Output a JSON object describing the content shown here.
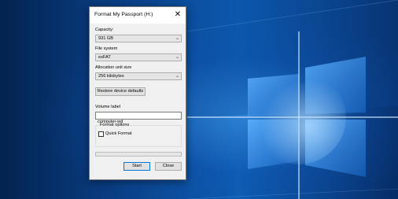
{
  "dialog": {
    "title": "Format My Passport (H:)",
    "capacity": {
      "label": "Capacity:",
      "value": "931 GB"
    },
    "file_system": {
      "label": "File system",
      "value": "exFAT"
    },
    "allocation": {
      "label": "Allocation unit size",
      "value": "256 kilobytes"
    },
    "restore_label": "Restore device defaults",
    "volume": {
      "label": "Volume label",
      "value": "computer-wd"
    },
    "format_options": {
      "title": "Format options",
      "quick_format_label": "Quick Format",
      "quick_format_checked": false
    },
    "progress": 0,
    "start_label": "Start",
    "close_label": "Close"
  },
  "icons": {
    "close": "close-icon",
    "chevron": "chevron-down-icon"
  },
  "colors": {
    "desktop_blue": "#0a3f86",
    "accent": "#0078d7"
  }
}
